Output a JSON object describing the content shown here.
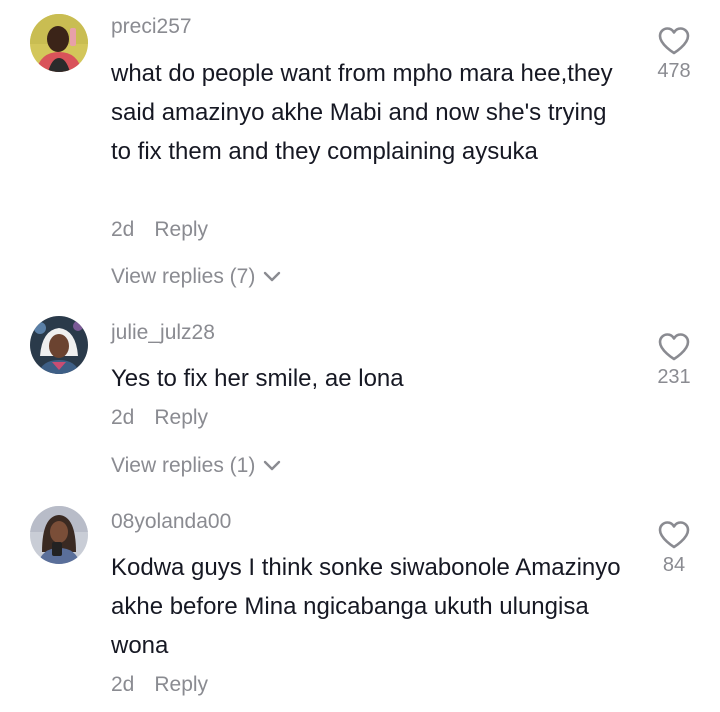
{
  "comments": [
    {
      "username": "preci257",
      "text": "what do people want from mpho mara hee,they said amazinyo akhe Mabi and now she's trying to fix them and they complaining aysuka",
      "age": "2d",
      "reply_label": "Reply",
      "view_replies": "View replies (7)",
      "likes": "478"
    },
    {
      "username": "julie_julz28",
      "text": "Yes to fix her smile, ae lona",
      "age": "2d",
      "reply_label": "Reply",
      "view_replies": "View replies (1)",
      "likes": "231"
    },
    {
      "username": "08yolanda00",
      "text": "Kodwa guys I think sonke siwabonole Amazinyo akhe before Mina ngicabanga ukuth ulungisa wona",
      "age": "2d",
      "reply_label": "Reply",
      "likes": "84"
    }
  ],
  "colors": {
    "text": "#161823",
    "secondary": "#8a8b91",
    "background": "#ffffff"
  },
  "icons": {
    "like": "heart-outline-icon",
    "expand": "chevron-down-icon"
  }
}
